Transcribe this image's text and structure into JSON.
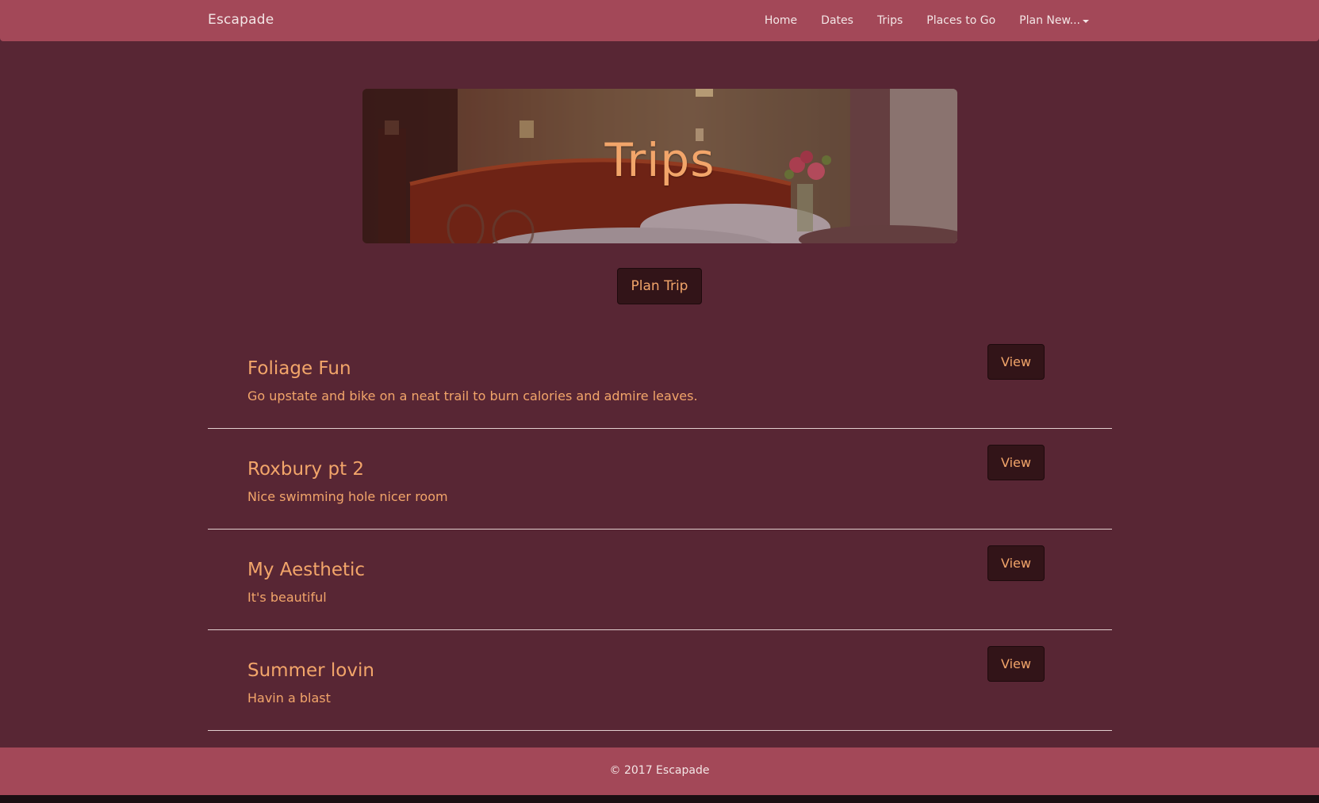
{
  "navbar": {
    "brand": "Escapade",
    "links": [
      {
        "label": "Home"
      },
      {
        "label": "Dates"
      },
      {
        "label": "Trips"
      },
      {
        "label": "Places to Go"
      },
      {
        "label": "Plan New..."
      }
    ],
    "dropdown_icon": "caret-down-icon"
  },
  "hero": {
    "title": "Trips",
    "image": "hotel-room-bed-flowers"
  },
  "actions": {
    "plan_trip_label": "Plan Trip"
  },
  "trips": [
    {
      "title": "Foliage Fun",
      "description": "Go upstate and bike on a neat trail to burn calories and admire leaves.",
      "button": "View"
    },
    {
      "title": "Roxbury pt 2",
      "description": "Nice swimming hole nicer room",
      "button": "View"
    },
    {
      "title": "My Aesthetic",
      "description": "It's beautiful",
      "button": "View"
    },
    {
      "title": "Summer lovin",
      "description": "Havin a blast",
      "button": "View"
    }
  ],
  "footer": {
    "text": "© 2017 Escapade"
  },
  "colors": {
    "navbar": "#a34858",
    "background": "#582634",
    "accent_text": "#f2a56a",
    "button_bg": "#321418"
  }
}
